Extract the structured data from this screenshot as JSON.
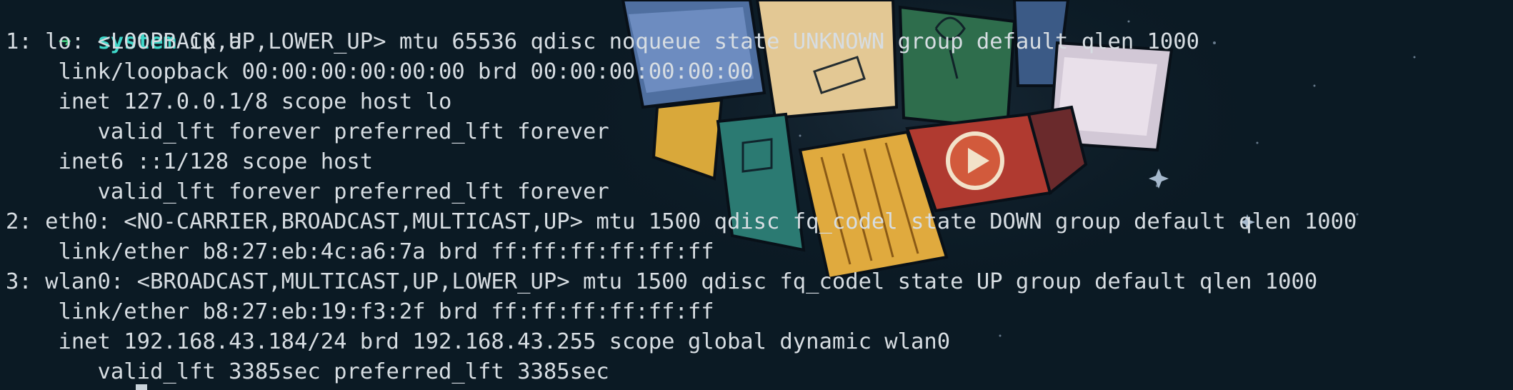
{
  "prompt": {
    "arrow": "➜",
    "directory": "system",
    "command": "ip a"
  },
  "output_lines": [
    "1: lo: <LOOPBACK,UP,LOWER_UP> mtu 65536 qdisc noqueue state UNKNOWN group default qlen 1000",
    "    link/loopback 00:00:00:00:00:00 brd 00:00:00:00:00:00",
    "    inet 127.0.0.1/8 scope host lo",
    "       valid_lft forever preferred_lft forever",
    "    inet6 ::1/128 scope host",
    "       valid_lft forever preferred_lft forever",
    "2: eth0: <NO-CARRIER,BROADCAST,MULTICAST,UP> mtu 1500 qdisc fq_codel state DOWN group default qlen 1000",
    "    link/ether b8:27:eb:4c:a6:7a brd ff:ff:ff:ff:ff:ff",
    "3: wlan0: <BROADCAST,MULTICAST,UP,LOWER_UP> mtu 1500 qdisc fq_codel state UP group default qlen 1000",
    "    link/ether b8:27:eb:19:f3:2f brd ff:ff:ff:ff:ff:ff",
    "    inet 192.168.43.184/24 brd 192.168.43.255 scope global dynamic wlan0",
    "       valid_lft 3385sec preferred_lft 3385sec"
  ],
  "colors": {
    "background": "#0b1a24",
    "text": "#d7dde2",
    "prompt_arrow": "#3ec77a",
    "prompt_directory": "#3ed6c8"
  }
}
